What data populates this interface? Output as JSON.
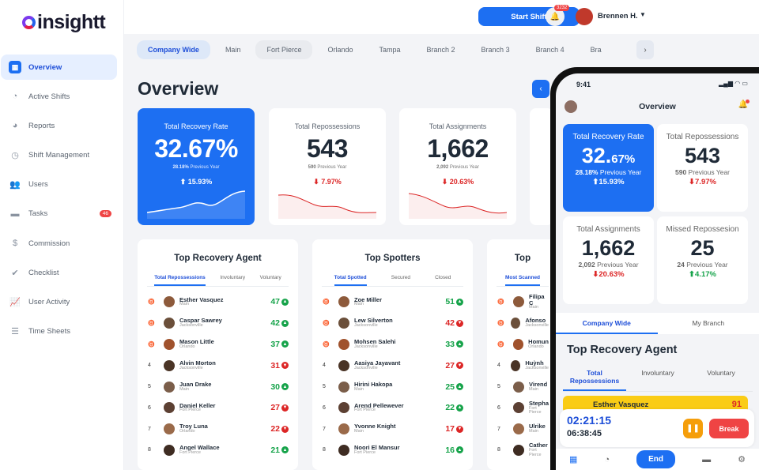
{
  "app": {
    "name": "insightt"
  },
  "sidebar": {
    "items": [
      {
        "label": "Overview",
        "icon": "grid-icon"
      },
      {
        "label": "Active Shifts",
        "icon": "gauge-icon"
      },
      {
        "label": "Reports",
        "icon": "pie-icon"
      },
      {
        "label": "Shift Management",
        "icon": "clock-icon"
      },
      {
        "label": "Users",
        "icon": "users-icon"
      },
      {
        "label": "Tasks",
        "icon": "folder-icon",
        "badge": "46"
      },
      {
        "label": "Commission",
        "icon": "dollar-icon"
      },
      {
        "label": "Checklist",
        "icon": "check-icon"
      },
      {
        "label": "User Activity",
        "icon": "activity-icon"
      },
      {
        "label": "Time Sheets",
        "icon": "list-icon"
      }
    ]
  },
  "topbar": {
    "start_shift": "Start Shift",
    "notif_count": "3232",
    "user_name": "Brennen H."
  },
  "tabs": [
    "Company Wide",
    "Main",
    "Fort Pierce",
    "Orlando",
    "Tampa",
    "Branch 2",
    "Branch 3",
    "Branch 4",
    "Bra"
  ],
  "page": {
    "title": "Overview"
  },
  "stats": [
    {
      "label": "Total Recovery Rate",
      "value": "32.67%",
      "sub_value": "28.18%",
      "sub_label": "Previous Year",
      "change": "15.93%"
    },
    {
      "label": "Total Repossessions",
      "value": "543",
      "sub_value": "590",
      "sub_label": "Previous Year",
      "change": "7.97%"
    },
    {
      "label": "Total Assignments",
      "value": "1,662",
      "sub_value": "2,092",
      "sub_label": "Previous Year",
      "change": "20.63%"
    }
  ],
  "cards": [
    {
      "title": "Top Recovery Agent",
      "tabs": [
        "Total Repossessions",
        "Involuntary",
        "Voluntary"
      ],
      "rows": [
        {
          "rank": "",
          "name": "Esther Vasquez",
          "branch": "Main",
          "score": "47",
          "dir": "up"
        },
        {
          "rank": "",
          "name": "Caspar Sawrey",
          "branch": "Jacksonville",
          "score": "42",
          "dir": "up"
        },
        {
          "rank": "",
          "name": "Mason Little",
          "branch": "Orlando",
          "score": "37",
          "dir": "up"
        },
        {
          "rank": "4",
          "name": "Alvin Morton",
          "branch": "Jacksonville",
          "score": "31",
          "dir": "dn"
        },
        {
          "rank": "5",
          "name": "Juan Drake",
          "branch": "Main",
          "score": "30",
          "dir": "up"
        },
        {
          "rank": "6",
          "name": "Daniel Keller",
          "branch": "Fort Pierce",
          "score": "27",
          "dir": "dn"
        },
        {
          "rank": "7",
          "name": "Troy Luna",
          "branch": "Orlando",
          "score": "22",
          "dir": "dn"
        },
        {
          "rank": "8",
          "name": "Angel Wallace",
          "branch": "Fort Pierce",
          "score": "21",
          "dir": "up"
        }
      ]
    },
    {
      "title": "Top Spotters",
      "tabs": [
        "Total Spotted",
        "Secured",
        "Closed"
      ],
      "rows": [
        {
          "rank": "",
          "name": "Zoe Miller",
          "branch": "Main",
          "score": "51",
          "dir": "up"
        },
        {
          "rank": "",
          "name": "Lew Silverton",
          "branch": "Jacksonville",
          "score": "42",
          "dir": "dn"
        },
        {
          "rank": "",
          "name": "Mohsen Salehi",
          "branch": "Jacksonville",
          "score": "33",
          "dir": "up"
        },
        {
          "rank": "4",
          "name": "Aasiya Jayavant",
          "branch": "Jacksonville",
          "score": "27",
          "dir": "dn"
        },
        {
          "rank": "5",
          "name": "Hirini Hakopa",
          "branch": "Main",
          "score": "25",
          "dir": "up"
        },
        {
          "rank": "6",
          "name": "Arend Pellewever",
          "branch": "Fort Pierce",
          "score": "22",
          "dir": "up"
        },
        {
          "rank": "7",
          "name": "Yvonne Knight",
          "branch": "Main",
          "score": "17",
          "dir": "dn"
        },
        {
          "rank": "8",
          "name": "Noori El Mansur",
          "branch": "Fort Pierce",
          "score": "16",
          "dir": "up"
        }
      ]
    },
    {
      "title": "Top",
      "tabs": [
        "Most Scanned"
      ],
      "rows": [
        {
          "rank": "",
          "name": "Filipa C",
          "branch": "Main",
          "score": "",
          "dir": "up"
        },
        {
          "rank": "",
          "name": "Afonso",
          "branch": "Jacksonville",
          "score": "",
          "dir": "up"
        },
        {
          "rank": "",
          "name": "Homun",
          "branch": "Orlando",
          "score": "",
          "dir": "up"
        },
        {
          "rank": "4",
          "name": "Huỳnh",
          "branch": "Jacksonville",
          "score": "",
          "dir": "up"
        },
        {
          "rank": "5",
          "name": "Virend",
          "branch": "Main",
          "score": "",
          "dir": "up"
        },
        {
          "rank": "6",
          "name": "Stepha",
          "branch": "Fort Pierce",
          "score": "",
          "dir": "up"
        },
        {
          "rank": "7",
          "name": "Ulrike",
          "branch": "Main",
          "score": "",
          "dir": "up"
        },
        {
          "rank": "8",
          "name": "Cather",
          "branch": "Fort Pierce",
          "score": "",
          "dir": "up"
        }
      ]
    }
  ],
  "phone": {
    "time": "9:41",
    "title": "Overview",
    "stats": [
      {
        "label": "Total Recovery Rate",
        "value": "32.",
        "value_small": "67%",
        "sub_value": "28.18%",
        "sub_label": "Previous Year",
        "change": "15.93%"
      },
      {
        "label": "Total Repossessions",
        "value": "543",
        "sub_value": "590",
        "sub_label": "Previous Year",
        "change": "7.97%"
      },
      {
        "label": "Total Assignments",
        "value": "1,662",
        "sub_value": "2,092",
        "sub_label": "Previous Year",
        "change": "20.63%"
      },
      {
        "label": "Missed Repossesion",
        "value": "25",
        "sub_value": "24",
        "sub_label": "Previous Year",
        "change": "4.17%"
      }
    ],
    "tabs": [
      "Company Wide",
      "My Branch"
    ],
    "section_title": "Top Recovery Agent",
    "subtabs": [
      "Total Repossessions",
      "Involuntary",
      "Voluntary"
    ],
    "first_row": {
      "name": "Esther Vasquez",
      "score": "91"
    },
    "shift": {
      "timer": "02:21:15",
      "clock": "06:38:45",
      "break_label": "Break"
    },
    "nav_end": "End"
  }
}
